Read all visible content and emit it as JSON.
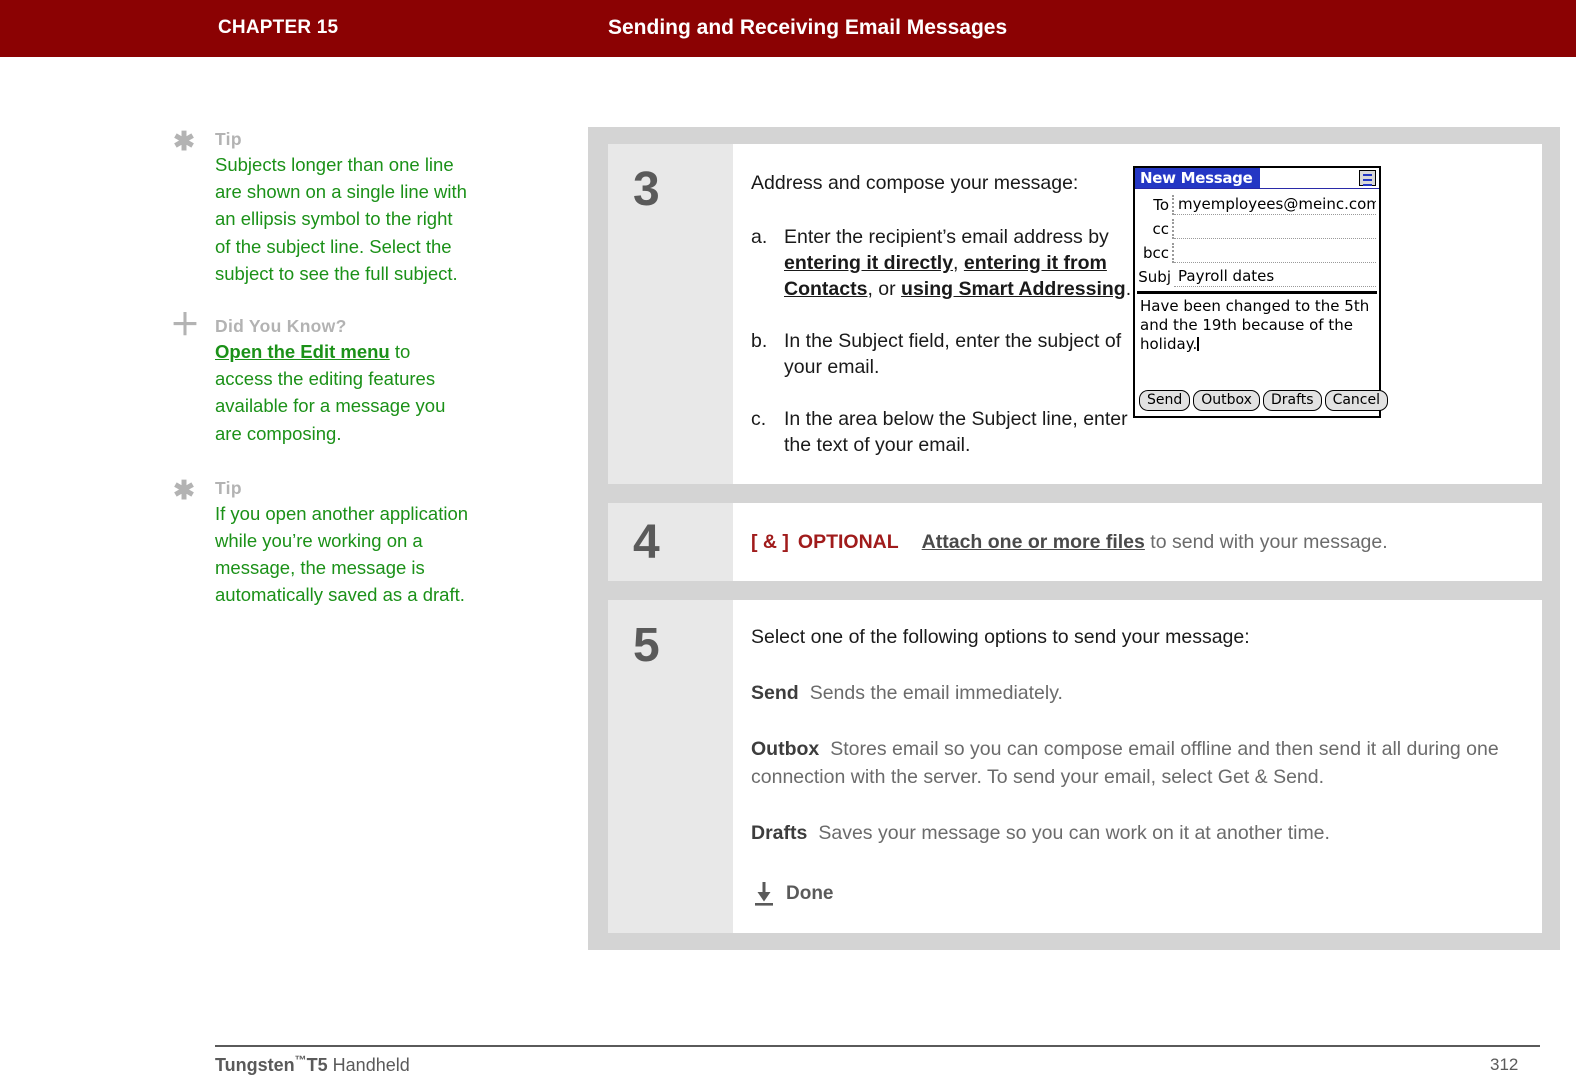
{
  "header": {
    "chapter_label": "CHAPTER 15",
    "title": "Sending and Receiving Email Messages",
    "bg_color": "#8b0203",
    "text_color": "#ffffff"
  },
  "sidebar": {
    "tips": [
      {
        "icon": "asterisk-icon",
        "icon_glyph": "✱",
        "heading": "Tip",
        "text": "Subjects longer than one line are shown on a single line with an ellipsis symbol to the right of the subject line. Select the subject to see the full subject."
      },
      {
        "icon": "plus-icon",
        "icon_glyph": "＋",
        "heading": "Did You Know?",
        "link_text": "Open the Edit menu",
        "text": " to access the editing features available for a message you are composing."
      },
      {
        "icon": "asterisk-icon",
        "icon_glyph": "✱",
        "heading": "Tip",
        "text": "If you open another application while you’re working on a message, the message is automatically saved as a draft."
      }
    ],
    "tip_heading_color": "#b3b3b3",
    "tip_text_color": "#1b9118"
  },
  "steps": [
    {
      "number": "3",
      "lead": "Address and compose your message:",
      "items": [
        {
          "marker": "a.",
          "pre": "Enter the recipient’s email address by ",
          "link1": "entering it directly",
          "mid1": ", ",
          "link2": "entering it from Contacts",
          "mid2": ", or ",
          "link3": "using Smart Addressing",
          "post": "."
        },
        {
          "marker": "b.",
          "pre": "In the Subject field, enter the subject of your email."
        },
        {
          "marker": "c.",
          "pre": "In the area below the Subject line, enter the text of your email."
        }
      ],
      "device": {
        "title": "New Message",
        "menu_icon": "menu-icon",
        "fields": [
          {
            "label": "To",
            "value": "myemployees@meinc.com"
          },
          {
            "label": "cc",
            "value": ""
          },
          {
            "label": "bcc",
            "value": ""
          }
        ],
        "subject_label": "Subj",
        "subject_value": "Payroll dates",
        "body": "Have been changed to the 5th and the 19th because of the holiday.",
        "buttons": [
          "Send",
          "Outbox",
          "Drafts",
          "Cancel"
        ],
        "titlebar_color": "#2437c4"
      }
    },
    {
      "number": "4",
      "optional_bracket": "[ & ]",
      "optional_label": "OPTIONAL",
      "link": "Attach one or more files",
      "tail": " to send with your message.",
      "optional_color": "#a01b1b"
    },
    {
      "number": "5",
      "lead": "Select one of the following options to send your message:",
      "options": [
        {
          "name": "Send",
          "desc": "Sends the email immediately."
        },
        {
          "name": "Outbox",
          "desc": "Stores email so you can compose email offline and then send it all during one connection with the server. To send your email, select Get & Send."
        },
        {
          "name": "Drafts",
          "desc": "Saves your message so you can work on it at another time."
        }
      ],
      "done": {
        "icon": "down-arrow-to-bar-icon",
        "label": "Done"
      }
    }
  ],
  "footer": {
    "product_name": "Tungsten",
    "trademark": "™",
    "model": "T5",
    "product_type": " Handheld",
    "page_number": "312"
  }
}
